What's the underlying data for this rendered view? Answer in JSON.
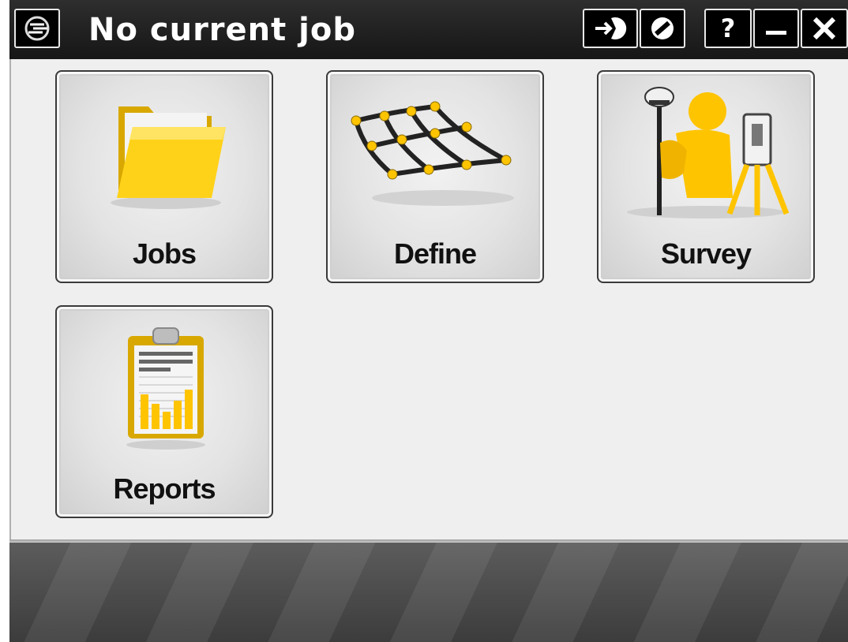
{
  "titlebar": {
    "title": "No current job",
    "app_icon": "trimble-logo-icon",
    "buttons": [
      {
        "icon": "login-arrow-icon"
      },
      {
        "icon": "no-entry-icon"
      },
      {
        "label": "?",
        "icon": "help-icon"
      },
      {
        "icon": "minimize-icon"
      },
      {
        "icon": "close-icon"
      }
    ]
  },
  "menu": {
    "tiles": [
      {
        "label": "Jobs",
        "icon": "folder-icon"
      },
      {
        "label": "Define",
        "icon": "grid-surface-icon"
      },
      {
        "label": "Survey",
        "icon": "surveyor-icon"
      },
      {
        "label": "Reports",
        "icon": "clipboard-report-icon"
      }
    ]
  },
  "colors": {
    "titlebar": "#1e1e1e",
    "content_bg": "#efefef",
    "icon_accent": "#f5c400",
    "bottombar": "#4a4a4a"
  }
}
